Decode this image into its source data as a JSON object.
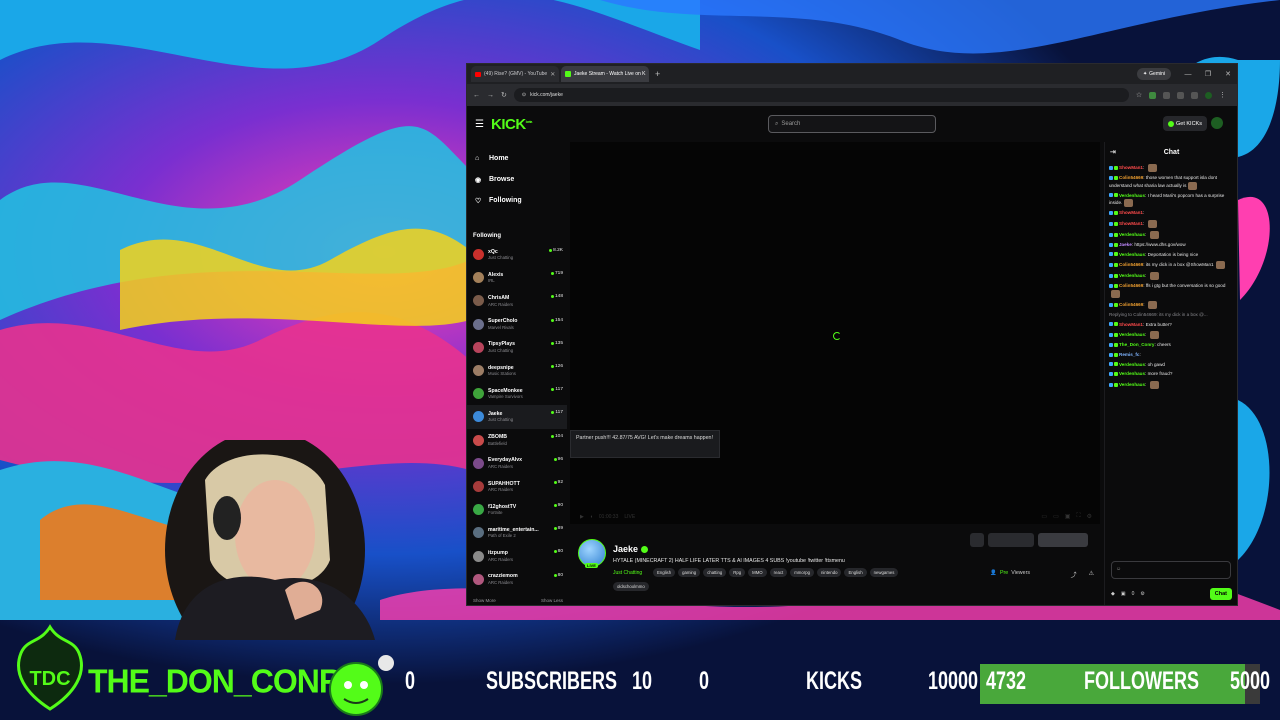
{
  "browser": {
    "tabs": [
      {
        "label": "(49) Rise? (GMV) - YouTube",
        "favicon": "youtube-icon",
        "active": false
      },
      {
        "label": "Jaeke Stream - Watch Live on K",
        "favicon": "kick-icon",
        "active": true
      }
    ],
    "new_tab": "+",
    "gemini_label": "Gemini",
    "url": "kick.com/jaeke"
  },
  "kick": {
    "logo": "KICK",
    "logo_sup": "beta",
    "search_placeholder": "Search",
    "get_kicks": "Get KICKs",
    "nav": [
      {
        "label": "Home",
        "icon": "home-icon"
      },
      {
        "label": "Browse",
        "icon": "compass-icon"
      },
      {
        "label": "Following",
        "icon": "heart-icon"
      }
    ],
    "following_heading": "Following",
    "following": [
      {
        "name": "xQc",
        "category": "Just Chatting",
        "viewers": "8.2K",
        "color": "#c9302c"
      },
      {
        "name": "Alexis",
        "category": "IRL",
        "viewers": "719",
        "color": "#a3805a"
      },
      {
        "name": "ChrisAM",
        "category": "ARC Raiders",
        "viewers": "148",
        "color": "#7a5b4a"
      },
      {
        "name": "SuperCholo",
        "category": "Marvel Rivals",
        "viewers": "154",
        "color": "#6b6f8c"
      },
      {
        "name": "TipsyPlays",
        "category": "Just Chatting",
        "viewers": "135",
        "color": "#b8445c"
      },
      {
        "name": "deepsnipe",
        "category": "Music Stations",
        "viewers": "126",
        "color": "#9c7d65"
      },
      {
        "name": "SpaceMonkee",
        "category": "Vampire Survivors",
        "viewers": "117",
        "color": "#3fa33a"
      },
      {
        "name": "Jaeke",
        "category": "Just Chatting",
        "viewers": "117",
        "color": "#3c8ad9"
      },
      {
        "name": "ZBOMB",
        "category": "Battlefield",
        "viewers": "104",
        "color": "#c94b4b"
      },
      {
        "name": "EverydayAlvx",
        "category": "ARC Raiders",
        "viewers": "96",
        "color": "#7b4a8a"
      },
      {
        "name": "SUPAHHOTT",
        "category": "ARC Raiders",
        "viewers": "92",
        "color": "#a63b3b"
      },
      {
        "name": "f12ghostTV",
        "category": "Fortnite",
        "viewers": "90",
        "color": "#39a845"
      },
      {
        "name": "maritime_entertain...",
        "category": "Path of Exile 2",
        "viewers": "89",
        "color": "#5a6e80"
      },
      {
        "name": "itzpump",
        "category": "ARC Raiders",
        "viewers": "80",
        "color": "#8a8a8a"
      },
      {
        "name": "crazziemom",
        "category": "ARC Raiders",
        "viewers": "80",
        "color": "#b0577e"
      }
    ],
    "show_more": "Show More",
    "show_less": "Show Less",
    "tooltip": "Partner push!!! 42.87/75 AVG! Let's make dreams happen!",
    "player_time": "01:00:33",
    "player_live": "LIVE",
    "stream": {
      "name": "Jaeke",
      "live_badge": "LIVE",
      "title": "HYTALE (MINECRAFT 2) HALF LIFE LATER TTS & AI IMAGES 4 SUBS !youtube !twitter !ttsmenu",
      "category": "Just Chatting",
      "tags": [
        "English",
        "gaming",
        "chatting",
        "Rpg",
        "MMO",
        "react",
        "mmorpg",
        "nintendo",
        "English",
        "newgames"
      ],
      "tag_second_row": "oldschoolmmo",
      "viewers_count": "Pre",
      "viewers_label": "Viewers"
    },
    "chat": {
      "title": "Chat",
      "messages": [
        {
          "user": "ShowMan1",
          "text": "",
          "color": "#ff4b4b",
          "emote": true
        },
        {
          "user": "Colin54669",
          "text": "those women that support isla dont understand what sharia law actually is",
          "color": "#f0a030",
          "emote": true
        },
        {
          "user": "Verdenhaus",
          "text": "I heard Marii's popcorn has a surprise inside.",
          "color": "#53fc18",
          "emote": true
        },
        {
          "user": "ShowMan1",
          "text": "",
          "color": "#ff4b4b",
          "emote": false
        },
        {
          "user": "ShowMan1",
          "text": "",
          "color": "#ff4b4b",
          "emote": true
        },
        {
          "user": "Verdenhaus",
          "text": "",
          "color": "#53fc18",
          "emote": true
        },
        {
          "user": "Jaeke",
          "text": "https://www.dhs.gov/wow",
          "color": "#c18aff",
          "emote": false
        },
        {
          "user": "Verdenhaus",
          "text": "Deportation is being nice",
          "color": "#53fc18",
          "emote": false
        },
        {
          "user": "Colin54669",
          "text": "its my dick in a box @ShowMan1",
          "color": "#f0a030",
          "emote": true
        },
        {
          "user": "Verdenhaus",
          "text": "",
          "color": "#53fc18",
          "emote": true
        },
        {
          "user": "Colin54669",
          "text": "ffs i gtg but the conversation is so good",
          "color": "#f0a030",
          "emote": true
        },
        {
          "user": "Colin54669",
          "text": "",
          "color": "#f0a030",
          "emote": true
        },
        {
          "user": "ShowMan1",
          "text": "Extra butter?",
          "color": "#ff4b4b",
          "emote": false
        },
        {
          "user": "Verdenhaus",
          "text": "",
          "color": "#53fc18",
          "emote": true
        },
        {
          "user": "The_Don_Conry",
          "text": "cheers",
          "color": "#53fc18",
          "emote": false
        },
        {
          "user": "Remis_fc",
          "text": "",
          "color": "#7fb4ff",
          "emote": false
        },
        {
          "user": "Verdenhaus",
          "text": "oh gawd",
          "color": "#53fc18",
          "emote": false
        },
        {
          "user": "Verdenhaus",
          "text": "more fraud?",
          "color": "#53fc18",
          "emote": false
        },
        {
          "user": "Verdenhaus",
          "text": "",
          "color": "#53fc18",
          "emote": true
        }
      ],
      "reply_line": "Replying to Colin54669: its my dick in a box @...",
      "input_placeholder": "",
      "kicks_count": "0",
      "send_label": "Chat"
    }
  },
  "overlay": {
    "display_name": "THE_DON_CONRY",
    "sub_current": "0",
    "sub_label": "SUBSCRIBERS",
    "sub_goal": "10",
    "kick_current": "0",
    "kick_label": "KICKS",
    "kick_goal": "10000",
    "follower_current": "4732",
    "follower_label": "FOLLOWERS",
    "follower_goal": "5000",
    "follower_progress": 0.9464,
    "accent": "#53fc18",
    "bar_fill": "#49a83b"
  }
}
